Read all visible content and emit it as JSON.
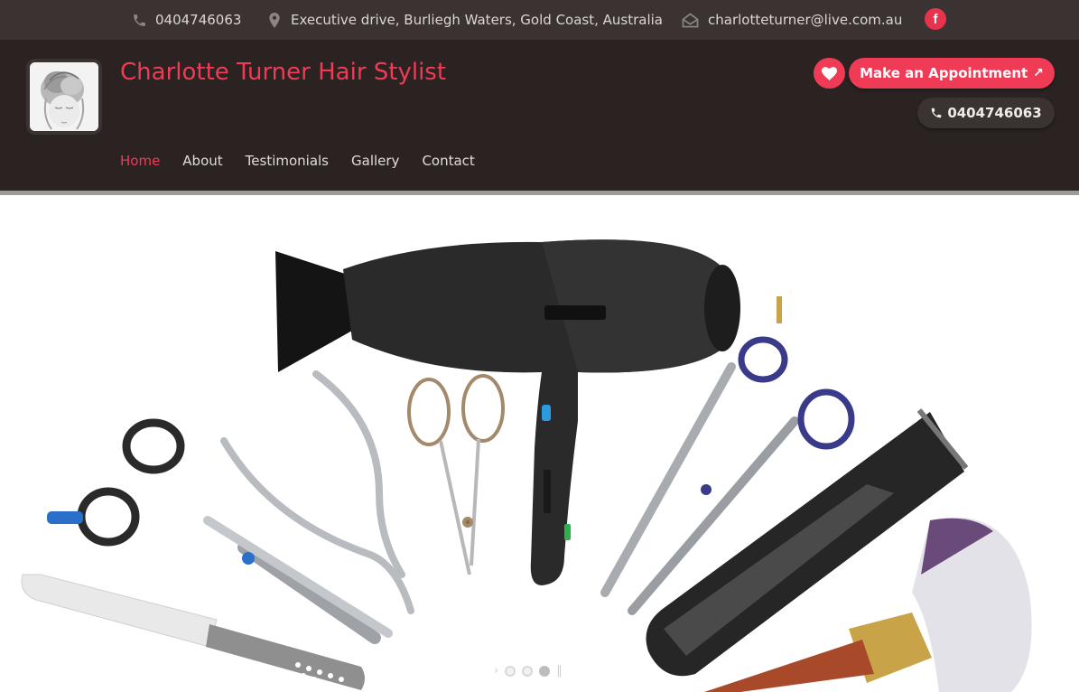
{
  "topbar": {
    "phone": "0404746063",
    "address": "Executive drive, Burliegh Waters, Gold Coast, Australia",
    "email": "charlotteturner@live.com.au",
    "facebook_icon": "f"
  },
  "header": {
    "site_title": "Charlotte Turner Hair Stylist",
    "appointment_label": "Make an Appointment",
    "appointment_arrow": "↗",
    "call_label": "0404746063"
  },
  "nav": {
    "items": [
      {
        "label": "Home",
        "active": true
      },
      {
        "label": "About",
        "active": false
      },
      {
        "label": "Testimonials",
        "active": false
      },
      {
        "label": "Gallery",
        "active": false
      },
      {
        "label": "Contact",
        "active": false
      }
    ]
  },
  "hero": {
    "slider": {
      "prev_glyph": "›",
      "next_glyph": "‖",
      "slide_count": 3,
      "active_index": 2
    }
  },
  "colors": {
    "accent": "#ef3b56",
    "topbar_bg": "#3a3332",
    "header_bg": "#2a2322"
  }
}
